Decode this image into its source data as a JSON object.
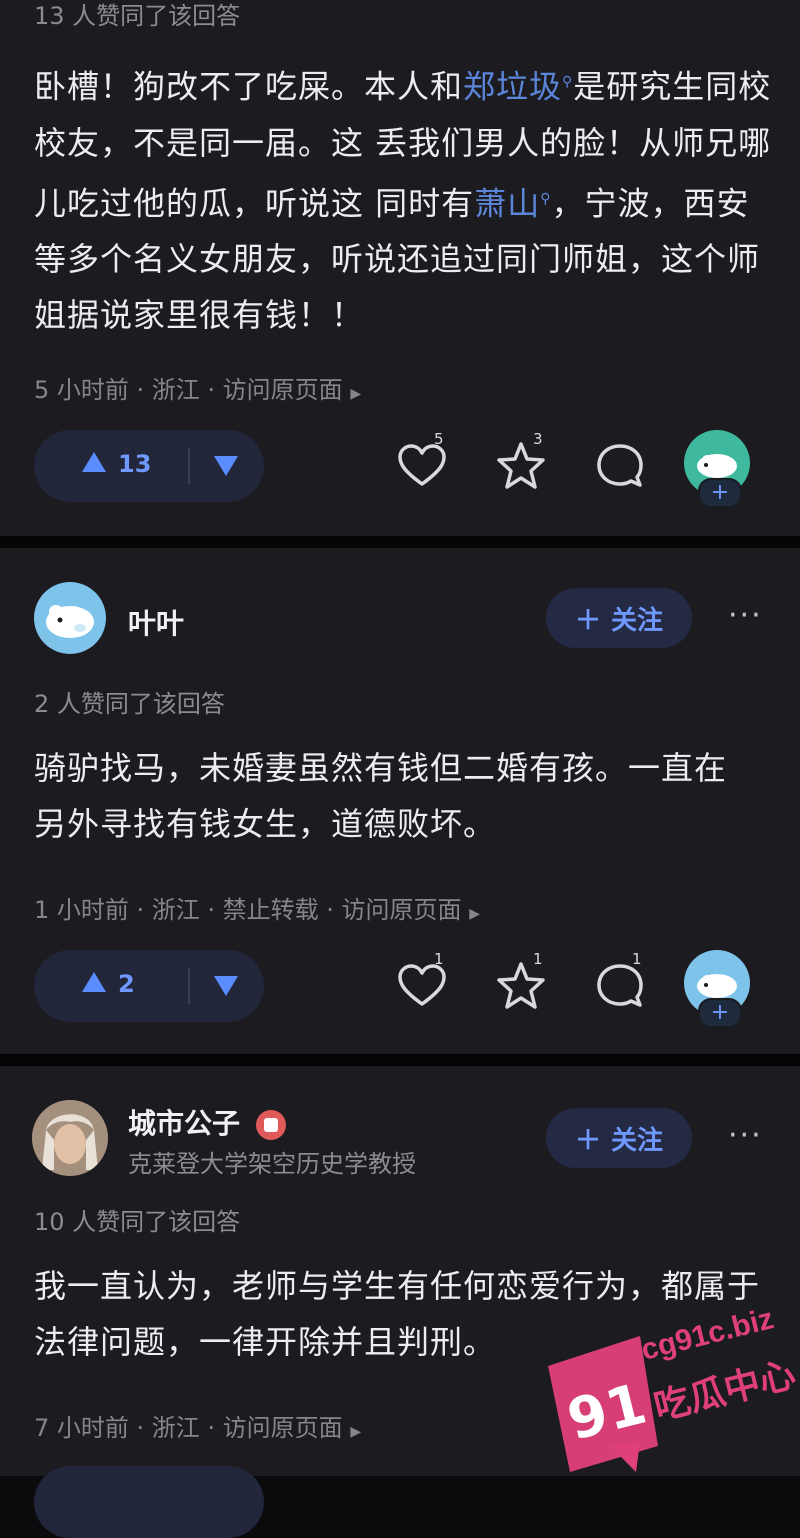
{
  "answers": [
    {
      "agree_text": "13 人赞同了该回答",
      "body_parts": [
        "卧槽！狗改不了吃屎。本人和",
        "郑垃圾",
        "是研究生同校校友，不是同一届。这 丢我们男人的脸！从师兄哪儿吃过他的瓜，听说这 同时有",
        "萧山",
        "，宁波，西安等多个名义女朋友，听说还追过同门师姐，这个师姐据说家里很有钱！！"
      ],
      "footer": "5 小时前 · 浙江 · 访问原页面",
      "upvotes": "13",
      "like_count": "5",
      "fav_count": "3",
      "comment_count": ""
    },
    {
      "author": "叶叶",
      "follow_label": "关注",
      "agree_text": "2 人赞同了该回答",
      "body": "骑驴找马，未婚妻虽然有钱但二婚有孩。一直在另外寻找有钱女生，道德败坏。",
      "footer": "1 小时前 · 浙江 · 禁止转载 · 访问原页面",
      "upvotes": "2",
      "like_count": "1",
      "fav_count": "1",
      "comment_count": "1"
    },
    {
      "author": "城市公子",
      "author_title": "克莱登大学架空历史学教授",
      "follow_label": "关注",
      "agree_text": "10 人赞同了该回答",
      "body": "我一直认为，老师与学生有任何恋爱行为，都属于法律问题，一律开除并且判刑。",
      "footer": "7 小时前 · 浙江 · 访问原页面"
    }
  ],
  "watermark": {
    "number": "91",
    "domain": "cg91c.biz",
    "name": "吃瓜中心"
  },
  "colors": {
    "card_bg": "#1b1b20",
    "accent": "#5b8dff",
    "link": "#5b86d9",
    "watermark": "#e0407a"
  }
}
